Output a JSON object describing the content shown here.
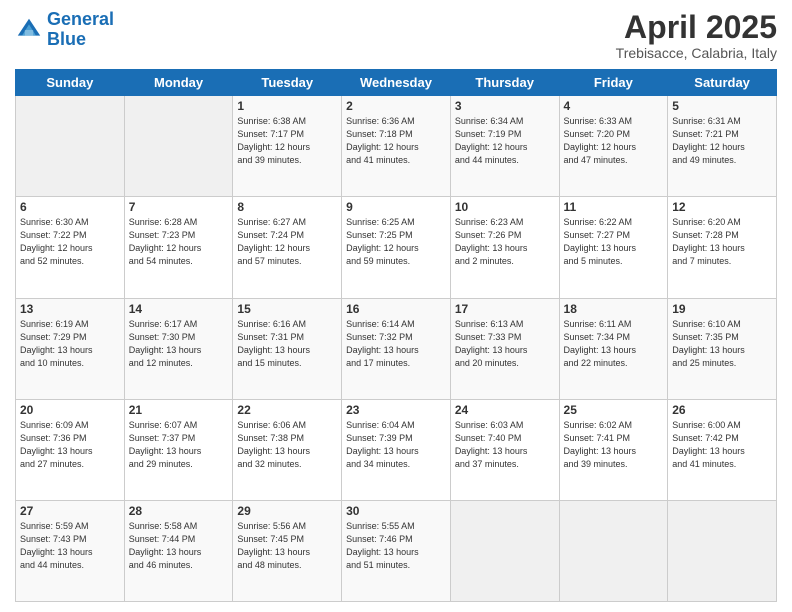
{
  "header": {
    "logo_line1": "General",
    "logo_line2": "Blue",
    "month": "April 2025",
    "location": "Trebisacce, Calabria, Italy"
  },
  "days_of_week": [
    "Sunday",
    "Monday",
    "Tuesday",
    "Wednesday",
    "Thursday",
    "Friday",
    "Saturday"
  ],
  "weeks": [
    [
      {
        "day": "",
        "info": ""
      },
      {
        "day": "",
        "info": ""
      },
      {
        "day": "1",
        "info": "Sunrise: 6:38 AM\nSunset: 7:17 PM\nDaylight: 12 hours\nand 39 minutes."
      },
      {
        "day": "2",
        "info": "Sunrise: 6:36 AM\nSunset: 7:18 PM\nDaylight: 12 hours\nand 41 minutes."
      },
      {
        "day": "3",
        "info": "Sunrise: 6:34 AM\nSunset: 7:19 PM\nDaylight: 12 hours\nand 44 minutes."
      },
      {
        "day": "4",
        "info": "Sunrise: 6:33 AM\nSunset: 7:20 PM\nDaylight: 12 hours\nand 47 minutes."
      },
      {
        "day": "5",
        "info": "Sunrise: 6:31 AM\nSunset: 7:21 PM\nDaylight: 12 hours\nand 49 minutes."
      }
    ],
    [
      {
        "day": "6",
        "info": "Sunrise: 6:30 AM\nSunset: 7:22 PM\nDaylight: 12 hours\nand 52 minutes."
      },
      {
        "day": "7",
        "info": "Sunrise: 6:28 AM\nSunset: 7:23 PM\nDaylight: 12 hours\nand 54 minutes."
      },
      {
        "day": "8",
        "info": "Sunrise: 6:27 AM\nSunset: 7:24 PM\nDaylight: 12 hours\nand 57 minutes."
      },
      {
        "day": "9",
        "info": "Sunrise: 6:25 AM\nSunset: 7:25 PM\nDaylight: 12 hours\nand 59 minutes."
      },
      {
        "day": "10",
        "info": "Sunrise: 6:23 AM\nSunset: 7:26 PM\nDaylight: 13 hours\nand 2 minutes."
      },
      {
        "day": "11",
        "info": "Sunrise: 6:22 AM\nSunset: 7:27 PM\nDaylight: 13 hours\nand 5 minutes."
      },
      {
        "day": "12",
        "info": "Sunrise: 6:20 AM\nSunset: 7:28 PM\nDaylight: 13 hours\nand 7 minutes."
      }
    ],
    [
      {
        "day": "13",
        "info": "Sunrise: 6:19 AM\nSunset: 7:29 PM\nDaylight: 13 hours\nand 10 minutes."
      },
      {
        "day": "14",
        "info": "Sunrise: 6:17 AM\nSunset: 7:30 PM\nDaylight: 13 hours\nand 12 minutes."
      },
      {
        "day": "15",
        "info": "Sunrise: 6:16 AM\nSunset: 7:31 PM\nDaylight: 13 hours\nand 15 minutes."
      },
      {
        "day": "16",
        "info": "Sunrise: 6:14 AM\nSunset: 7:32 PM\nDaylight: 13 hours\nand 17 minutes."
      },
      {
        "day": "17",
        "info": "Sunrise: 6:13 AM\nSunset: 7:33 PM\nDaylight: 13 hours\nand 20 minutes."
      },
      {
        "day": "18",
        "info": "Sunrise: 6:11 AM\nSunset: 7:34 PM\nDaylight: 13 hours\nand 22 minutes."
      },
      {
        "day": "19",
        "info": "Sunrise: 6:10 AM\nSunset: 7:35 PM\nDaylight: 13 hours\nand 25 minutes."
      }
    ],
    [
      {
        "day": "20",
        "info": "Sunrise: 6:09 AM\nSunset: 7:36 PM\nDaylight: 13 hours\nand 27 minutes."
      },
      {
        "day": "21",
        "info": "Sunrise: 6:07 AM\nSunset: 7:37 PM\nDaylight: 13 hours\nand 29 minutes."
      },
      {
        "day": "22",
        "info": "Sunrise: 6:06 AM\nSunset: 7:38 PM\nDaylight: 13 hours\nand 32 minutes."
      },
      {
        "day": "23",
        "info": "Sunrise: 6:04 AM\nSunset: 7:39 PM\nDaylight: 13 hours\nand 34 minutes."
      },
      {
        "day": "24",
        "info": "Sunrise: 6:03 AM\nSunset: 7:40 PM\nDaylight: 13 hours\nand 37 minutes."
      },
      {
        "day": "25",
        "info": "Sunrise: 6:02 AM\nSunset: 7:41 PM\nDaylight: 13 hours\nand 39 minutes."
      },
      {
        "day": "26",
        "info": "Sunrise: 6:00 AM\nSunset: 7:42 PM\nDaylight: 13 hours\nand 41 minutes."
      }
    ],
    [
      {
        "day": "27",
        "info": "Sunrise: 5:59 AM\nSunset: 7:43 PM\nDaylight: 13 hours\nand 44 minutes."
      },
      {
        "day": "28",
        "info": "Sunrise: 5:58 AM\nSunset: 7:44 PM\nDaylight: 13 hours\nand 46 minutes."
      },
      {
        "day": "29",
        "info": "Sunrise: 5:56 AM\nSunset: 7:45 PM\nDaylight: 13 hours\nand 48 minutes."
      },
      {
        "day": "30",
        "info": "Sunrise: 5:55 AM\nSunset: 7:46 PM\nDaylight: 13 hours\nand 51 minutes."
      },
      {
        "day": "",
        "info": ""
      },
      {
        "day": "",
        "info": ""
      },
      {
        "day": "",
        "info": ""
      }
    ]
  ]
}
